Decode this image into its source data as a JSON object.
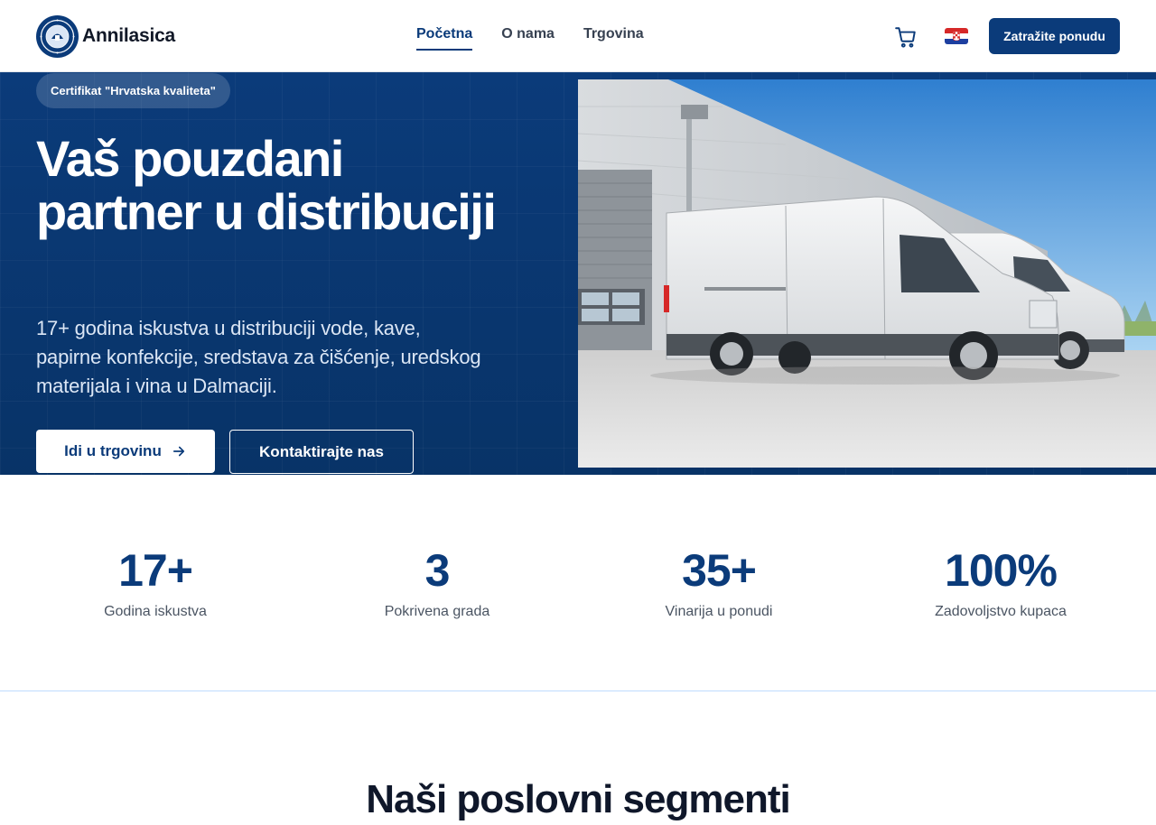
{
  "header": {
    "brand_name": "Annilasica",
    "nav": [
      {
        "label": "Početna",
        "active": true
      },
      {
        "label": "O nama",
        "active": false
      },
      {
        "label": "Trgovina",
        "active": false
      }
    ],
    "cart_icon": "shopping-cart-icon",
    "language_flag": "croatian-flag-icon",
    "cta_label": "Zatražite ponudu"
  },
  "hero": {
    "badge": "Certifikat \"Hrvatska kvaliteta\"",
    "title": "Vaš pouzdani partner u distribuciji",
    "subtitle": "17+ godina iskustva u distribuciji vode, kave, papirne konfekcije, sredstava za čišćenje, uredskog materijala i vina u Dalmaciji.",
    "primary_button": "Idi u trgovinu",
    "secondary_button": "Kontaktirajte nas",
    "image_subject": "white delivery vans at warehouse"
  },
  "stats": [
    {
      "value": "17+",
      "label": "Godina iskustva"
    },
    {
      "value": "3",
      "label": "Pokrivena grada"
    },
    {
      "value": "35+",
      "label": "Vinarija u ponudi"
    },
    {
      "value": "100%",
      "label": "Zadovoljstvo kupaca"
    }
  ],
  "segments": {
    "title": "Naši poslovni segmenti"
  },
  "colors": {
    "brand_primary": "#0b3b7a",
    "hero_background": "#0b3b7a",
    "text_dark": "#0f172a",
    "text_muted": "#4b5563"
  }
}
